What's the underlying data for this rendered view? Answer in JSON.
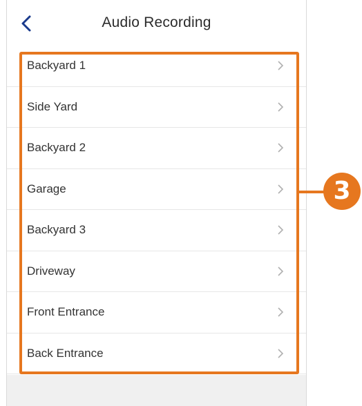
{
  "header": {
    "title": "Audio Recording",
    "back_icon": "chevron-left-icon"
  },
  "list": {
    "items": [
      {
        "label": "Backyard 1"
      },
      {
        "label": "Side Yard"
      },
      {
        "label": "Backyard 2"
      },
      {
        "label": "Garage"
      },
      {
        "label": "Backyard 3"
      },
      {
        "label": "Driveway"
      },
      {
        "label": "Front Entrance"
      },
      {
        "label": "Back Entrance"
      }
    ],
    "item_icon": "chevron-right-icon"
  },
  "annotation": {
    "badge_number": "3",
    "color": "#e6771f"
  },
  "colors": {
    "accent": "#1a3a8c",
    "text": "#333333",
    "divider": "#e6e6e6",
    "footer": "#f0f0f0"
  }
}
